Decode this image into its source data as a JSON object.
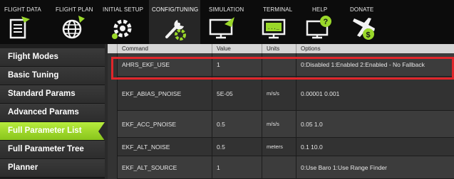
{
  "menu": {
    "items": [
      {
        "label": "FLIGHT DATA",
        "icon": "flight-data-icon"
      },
      {
        "label": "FLIGHT PLAN",
        "icon": "flight-plan-icon"
      },
      {
        "label": "INITIAL SETUP",
        "icon": "initial-setup-icon"
      },
      {
        "label": "CONFIG/TUNING",
        "icon": "config-tuning-icon"
      },
      {
        "label": "SIMULATION",
        "icon": "simulation-icon"
      },
      {
        "label": "TERMINAL",
        "icon": "terminal-icon"
      },
      {
        "label": "HELP",
        "icon": "help-icon"
      },
      {
        "label": "DONATE",
        "icon": "donate-icon"
      }
    ],
    "active": "CONFIG/TUNING"
  },
  "sidebar": {
    "items": [
      {
        "label": "Flight Modes"
      },
      {
        "label": "Basic Tuning"
      },
      {
        "label": "Standard Params"
      },
      {
        "label": "Advanced Params"
      },
      {
        "label": "Full Parameter List"
      },
      {
        "label": "Full Parameter Tree"
      },
      {
        "label": "Planner"
      }
    ],
    "active": "Full Parameter List"
  },
  "table": {
    "columns": [
      "Command",
      "Value",
      "Units",
      "Options"
    ],
    "rows": [
      {
        "command": "AHRS_EKF_USE",
        "value": "1",
        "units": "",
        "options": "0:Disabled 1:Enabled 2:Enabled - No Fallback"
      },
      {
        "command": "EKF_ABIAS_PNOISE",
        "value": "5E-05",
        "units": "m/s/s",
        "options": "0.00001 0.001"
      },
      {
        "command": "EKF_ACC_PNOISE",
        "value": "0.5",
        "units": "m/s/s",
        "options": "0.05 1.0"
      },
      {
        "command": "EKF_ALT_NOISE",
        "value": "0.5",
        "units": "meters",
        "options": "0.1 10.0"
      },
      {
        "command": "EKF_ALT_SOURCE",
        "value": "1",
        "units": "",
        "options": "0:Use Baro 1:Use Range Finder"
      }
    ],
    "highlighted_row": "AHRS_EKF_USE"
  },
  "colors": {
    "menu_bg": "#0c0c0c",
    "accent_green": "#9ad82a",
    "highlight_red": "#e0262b",
    "table_bg": "#2b2b2b"
  }
}
